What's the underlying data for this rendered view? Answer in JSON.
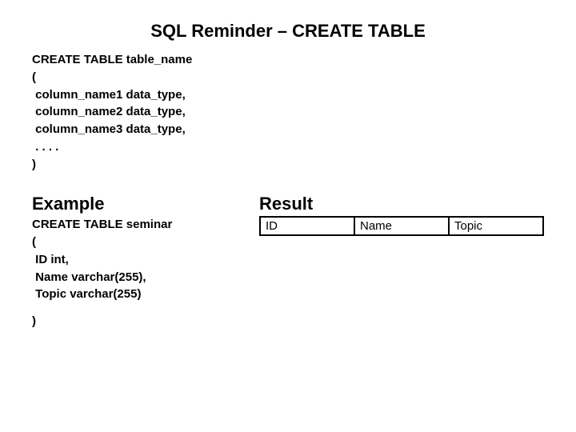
{
  "title": "SQL Reminder – CREATE TABLE",
  "syntax": {
    "l1": "CREATE TABLE table_name",
    "l2": "(",
    "l3": " column_name1 data_type,",
    "l4": " column_name2 data_type,",
    "l5": " column_name3 data_type,",
    "l6": " . . . .",
    "l7": ")"
  },
  "example_heading": "Example",
  "example": {
    "l1": "CREATE TABLE seminar",
    "l2": "(",
    "l3": " ID int,",
    "l4": " Name varchar(255),",
    "l5": " Topic varchar(255)",
    "l6": ")"
  },
  "result_heading": "Result",
  "result_table": {
    "headers": [
      "ID",
      "Name",
      "Topic"
    ]
  }
}
